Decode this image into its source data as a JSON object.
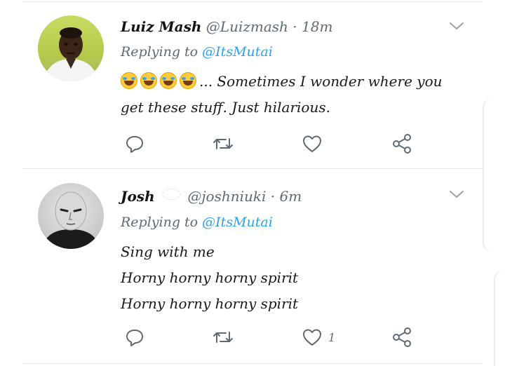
{
  "tweets": [
    {
      "name": "Luiz Mash",
      "handle": "@Luizmash",
      "separator": "·",
      "time": "18m",
      "replying_prefix": "Replying to",
      "replying_to": "@ItsMutai",
      "emoji_count": 4,
      "lines": [
        "... Sometimes I wonder where you",
        "get these stuff. Just hilarious."
      ],
      "like_count": ""
    },
    {
      "name": "Josh",
      "handle": "@joshniuki",
      "separator": "·",
      "time": "6m",
      "replying_prefix": "Replying to",
      "replying_to": "@ItsMutai",
      "lines": [
        "Sing with me",
        "Horny horny horny spirit",
        "Horny horny horny spirit"
      ],
      "like_count": "1"
    }
  ],
  "icons": {
    "reply": "reply-icon",
    "retweet": "retweet-icon",
    "like": "heart-icon",
    "share": "share-icon",
    "caret": "chevron-down-icon"
  },
  "colors": {
    "mention": "#2aa3ef",
    "muted": "#5e6a74",
    "divider": "#e3e5e8"
  }
}
